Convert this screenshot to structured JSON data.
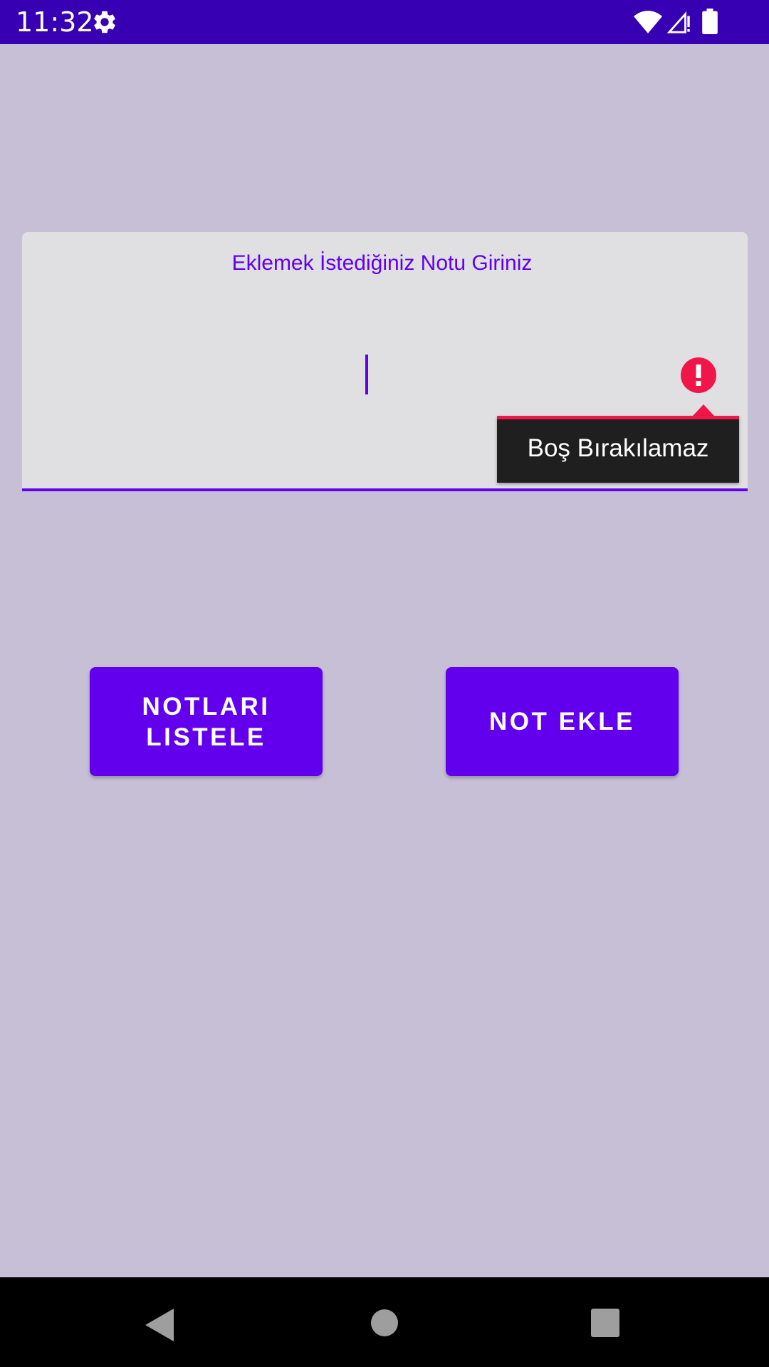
{
  "status_bar": {
    "time": "11:32",
    "icons": [
      "settings-gear-icon",
      "wifi-icon",
      "cellular-signal-icon",
      "battery-icon"
    ],
    "background_color": "#3700b3"
  },
  "note_input": {
    "hint": "Eklemek İstediğiniz Notu Giriniz",
    "value": "",
    "error_icon": "error-exclamation-icon",
    "error_message": "Boş Bırakılamaz",
    "accent_color": "#6200ee",
    "error_color": "#f0164a"
  },
  "buttons": {
    "list_notes": "NOTLARI LISTELE",
    "add_note": "NOT EKLE"
  },
  "navigation_bar": {
    "icons": [
      "back-icon",
      "home-icon",
      "recents-icon"
    ]
  },
  "colors": {
    "background": "#c6bfd6",
    "button": "#6200ee"
  }
}
